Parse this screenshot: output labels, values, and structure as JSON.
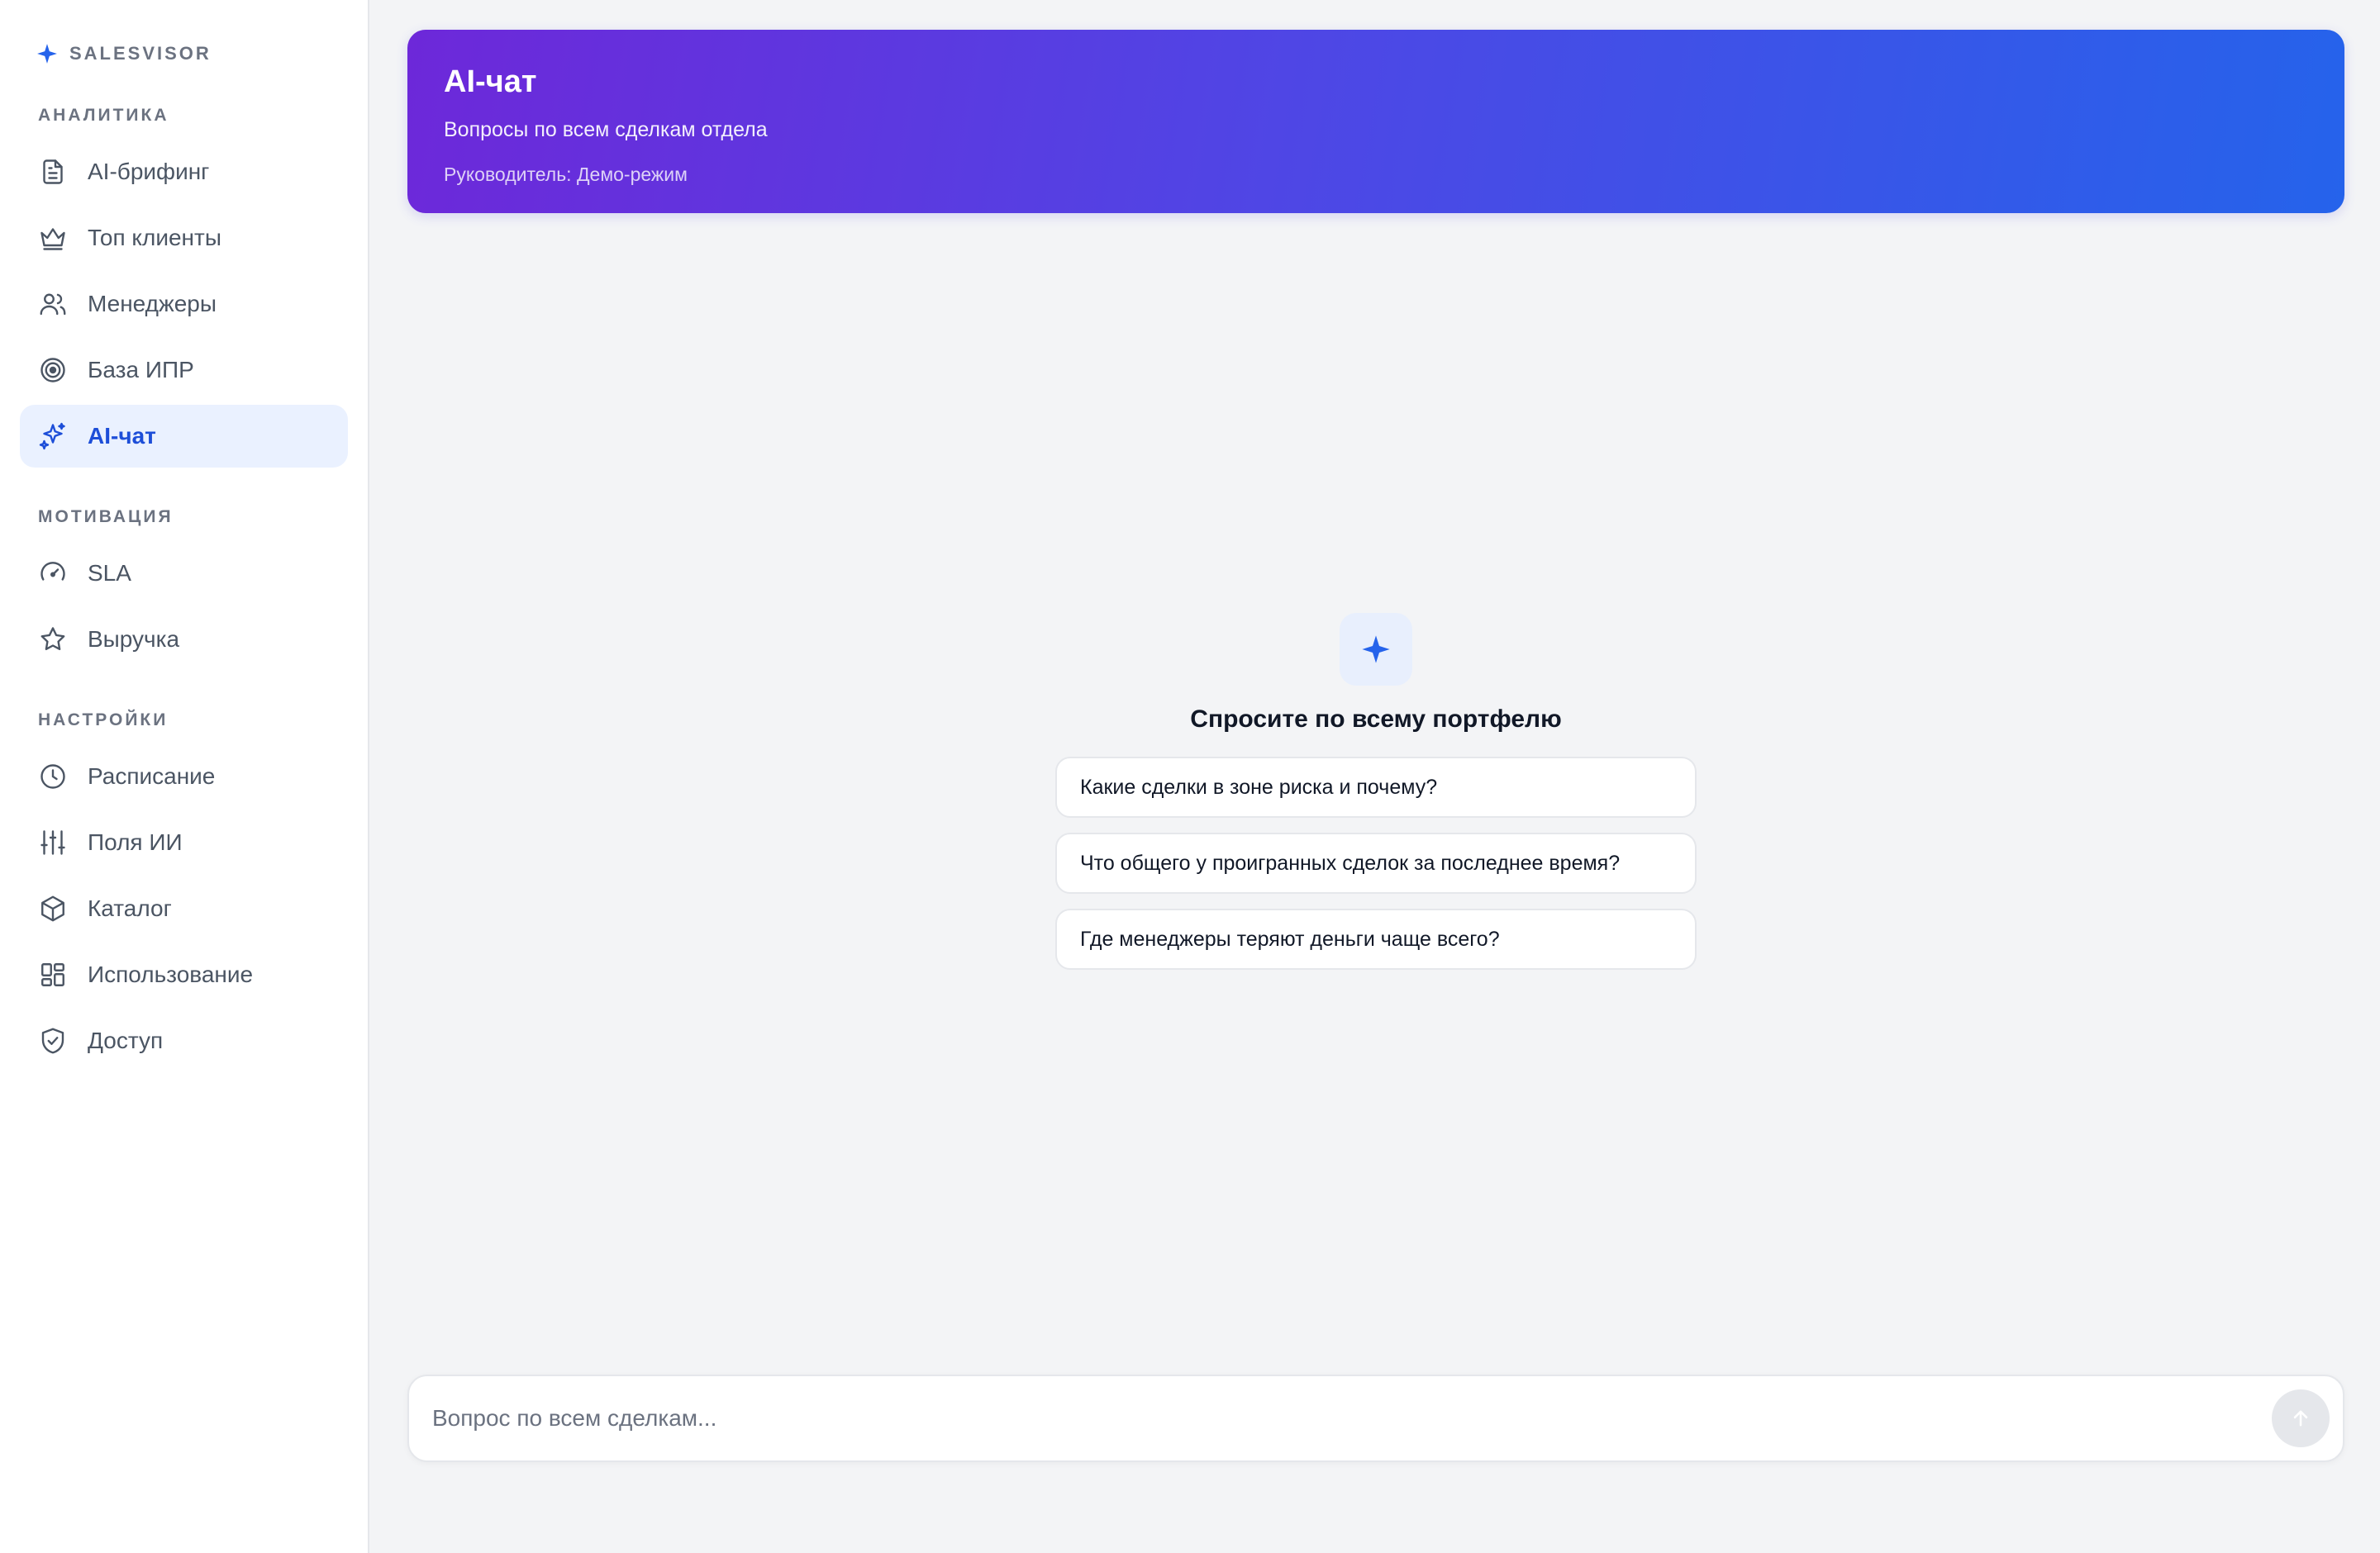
{
  "brand": {
    "name": "SALESVISOR",
    "accent": "#2563eb"
  },
  "sidebar": {
    "sections": [
      {
        "title": "АНАЛИТИКА",
        "items": [
          {
            "label": "AI-брифинг",
            "icon": "document-icon"
          },
          {
            "label": "Топ клиенты",
            "icon": "crown-icon"
          },
          {
            "label": "Менеджеры",
            "icon": "users-icon"
          },
          {
            "label": "База ИПР",
            "icon": "target-icon"
          },
          {
            "label": "AI-чат",
            "icon": "sparkles-icon",
            "active": true
          }
        ]
      },
      {
        "title": "МОТИВАЦИЯ",
        "items": [
          {
            "label": "SLA",
            "icon": "gauge-icon"
          },
          {
            "label": "Выручка",
            "icon": "star-icon"
          }
        ]
      },
      {
        "title": "НАСТРОЙКИ",
        "items": [
          {
            "label": "Расписание",
            "icon": "clock-icon"
          },
          {
            "label": "Поля ИИ",
            "icon": "sliders-icon"
          },
          {
            "label": "Каталог",
            "icon": "box-icon"
          },
          {
            "label": "Использование",
            "icon": "grid-icon"
          },
          {
            "label": "Доступ",
            "icon": "shield-check-icon"
          }
        ]
      }
    ]
  },
  "header": {
    "title": "AI-чат",
    "subtitle": "Вопросы по всем сделкам отдела",
    "meta": "Руководитель: Демо-режим",
    "gradient": [
      "#6d28d9",
      "#2563eb"
    ]
  },
  "empty_state": {
    "icon": "sparkle-icon",
    "title": "Спросите по всему портфелю",
    "suggestions": [
      "Какие сделки в зоне риска и почему?",
      "Что общего у проигранных сделок за последнее время?",
      "Где менеджеры теряют деньги чаще всего?"
    ]
  },
  "composer": {
    "placeholder": "Вопрос по всем сделкам...",
    "value": "",
    "send_icon": "arrow-up-icon"
  }
}
